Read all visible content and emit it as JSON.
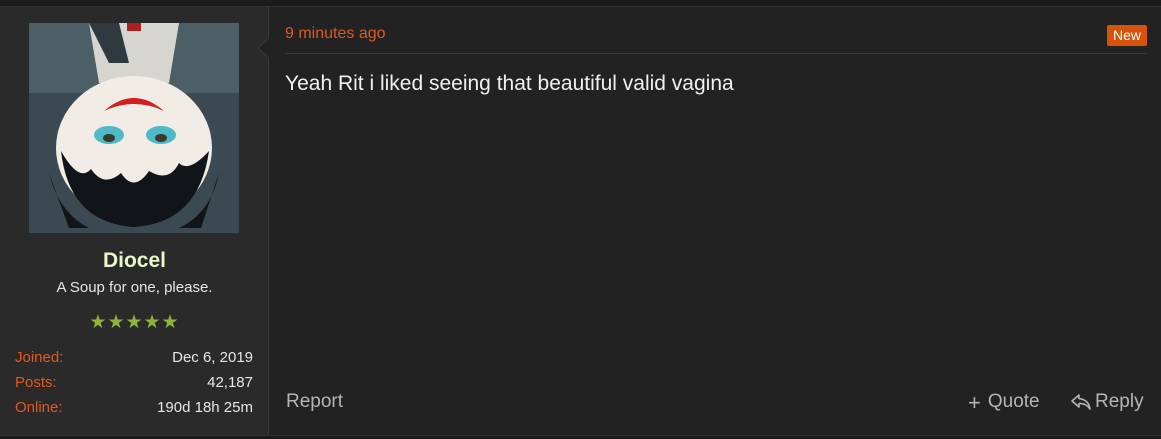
{
  "user": {
    "username": "Diocel",
    "title": "A Soup for one, please.",
    "stars": "★★★★★",
    "stats": [
      {
        "label": "Joined:",
        "value": "Dec 6, 2019"
      },
      {
        "label": "Posts:",
        "value": "42,187"
      },
      {
        "label": "Online:",
        "value": "190d 18h 25m"
      }
    ]
  },
  "post": {
    "timestamp": "9 minutes ago",
    "badge": "New",
    "message": "Yeah Rit i liked seeing that beautiful valid vagina"
  },
  "actions": {
    "report": "Report",
    "quote": "Quote",
    "reply": "Reply"
  },
  "icons": {
    "quote": "plus-icon",
    "reply": "reply-arrow-icon"
  },
  "colors": {
    "accent": "#e05a1e",
    "username": "#e9f7c9",
    "stars": "#8db53a",
    "badge": "#d9520b"
  }
}
